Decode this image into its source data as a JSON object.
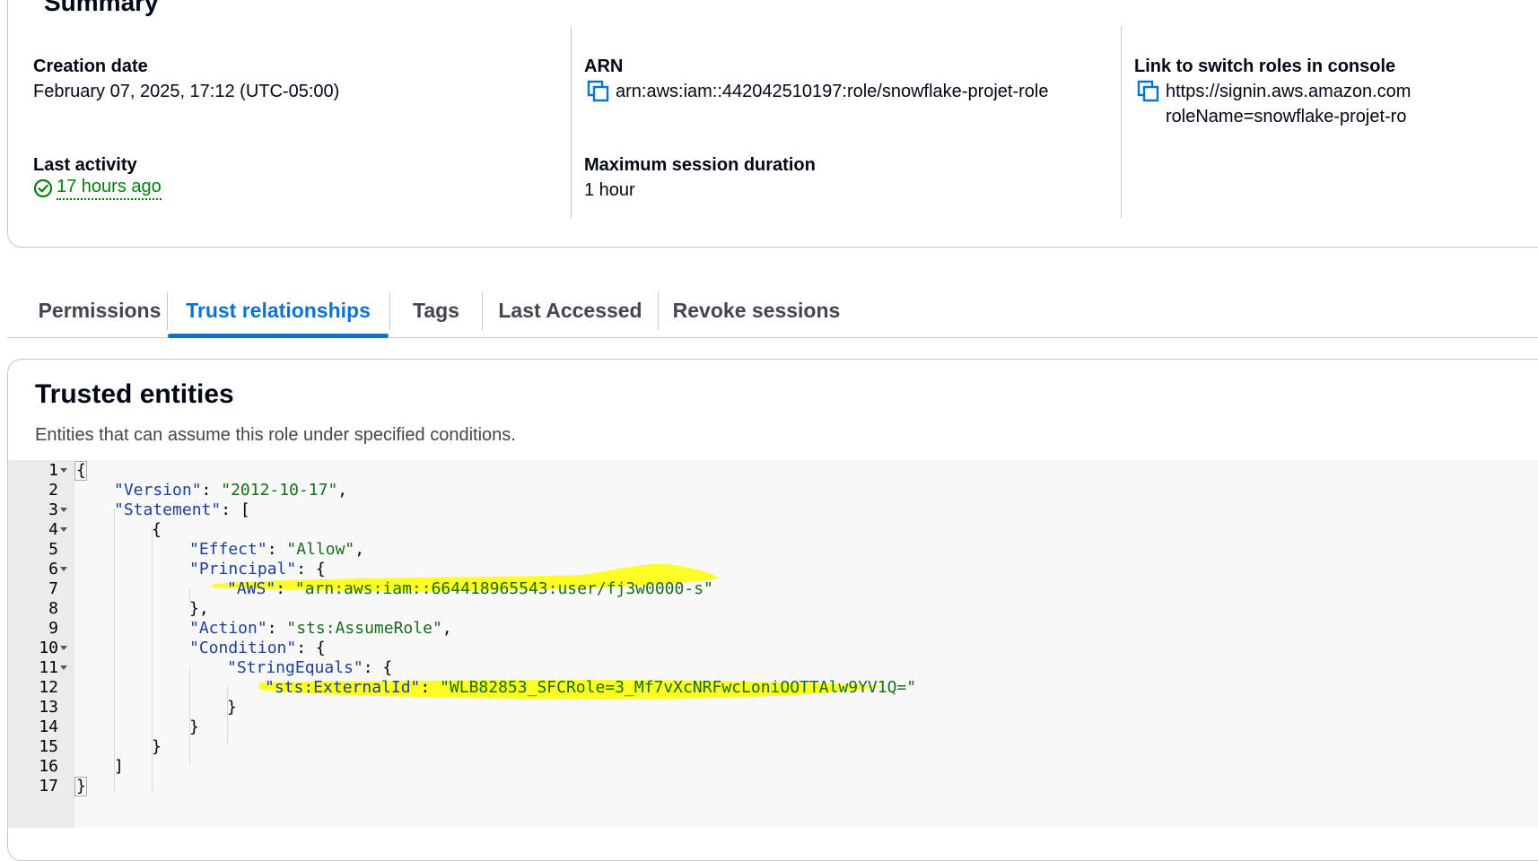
{
  "summary": {
    "title": "Summary",
    "creation_date_label": "Creation date",
    "creation_date_value": "February 07, 2025, 17:12 (UTC-05:00)",
    "last_activity_label": "Last activity",
    "last_activity_value": "17 hours ago",
    "arn_label": "ARN",
    "arn_value": "arn:aws:iam::442042510197:role/snowflake-projet-role",
    "max_session_label": "Maximum session duration",
    "max_session_value": "1 hour",
    "switch_link_label": "Link to switch roles in console",
    "switch_link_line1": "https://signin.aws.amazon.com",
    "switch_link_line2": "roleName=snowflake-projet-ro"
  },
  "tabs": [
    {
      "label": "Permissions",
      "active": false
    },
    {
      "label": "Trust relationships",
      "active": true
    },
    {
      "label": "Tags",
      "active": false
    },
    {
      "label": "Last Accessed",
      "active": false
    },
    {
      "label": "Revoke sessions",
      "active": false
    }
  ],
  "trusted": {
    "title": "Trusted entities",
    "description": "Entities that can assume this role under specified conditions."
  },
  "code": {
    "line_numbers": [
      "1",
      "2",
      "3",
      "4",
      "5",
      "6",
      "7",
      "8",
      "9",
      "10",
      "11",
      "12",
      "13",
      "14",
      "15",
      "16",
      "17"
    ],
    "open_brace": "{",
    "version_key": "\"Version\"",
    "version_val": "\"2012-10-17\"",
    "statement_key": "\"Statement\"",
    "open_bracket": "[",
    "effect_key": "\"Effect\"",
    "effect_val": "\"Allow\"",
    "principal_key": "\"Principal\"",
    "aws_key": "\"AWS\"",
    "aws_val": "\"arn:aws:iam::664418965543:user/fj3w0000-s\"",
    "close_brace_comma": "},",
    "action_key": "\"Action\"",
    "action_val": "\"sts:AssumeRole\"",
    "condition_key": "\"Condition\"",
    "stringequals_key": "\"StringEquals\"",
    "externalid_key": "\"sts:ExternalId\"",
    "externalid_val": "\"WLB82853_SFCRole=3_Mf7vXcNRFwcLoniOOTTAlw9YV1Q=\"",
    "close_brace": "}",
    "close_bracket": "]",
    "colon": ": ",
    "colon_brace": ": {",
    "colon_bracket": ": [",
    "comma": ","
  },
  "colors": {
    "accent": "#0972d3",
    "success": "#037f0c",
    "highlight": "#ffff00"
  }
}
